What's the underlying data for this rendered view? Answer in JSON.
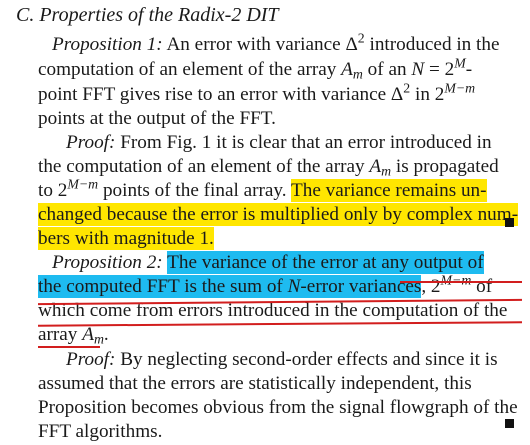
{
  "section": {
    "heading": "C. Properties of the Radix-2 DIT"
  },
  "prop1": {
    "label": "Proposition 1:",
    "l1_text": "An error with variance Δ",
    "l1_sup": "2",
    "l1_tail": " introduced in the",
    "l2_a": "computation of an element of the array ",
    "l2_A": "A",
    "l2_m": "m",
    "l2_b": " of an ",
    "l2_N": "N",
    "l2_c": " = 2",
    "l2_sup": "M",
    "l2_d": "-",
    "l3_a": "point FFT gives rise to an error with variance Δ",
    "l3_sup1": "2",
    "l3_b": " in 2",
    "l3_sup2": "M−m",
    "l4": "points at the output of the FFT."
  },
  "proof1": {
    "label": "Proof:",
    "l1": " From Fig. 1 it is clear that an error introduced in",
    "l2_a": "the computation of an element of the array ",
    "l2_A": "A",
    "l2_m": "m",
    "l2_b": " is propagated",
    "l3_a": "to 2",
    "l3_sup": "M−m",
    "l3_b": " points of the final array.  ",
    "l3_hl": "The variance remains un-",
    "l4_hl": "changed because the error is multiplied only by complex num-",
    "l5_hl": "bers with magnitude 1."
  },
  "prop2": {
    "label": "Proposition 2:",
    "l1_hl": "The variance of the error at any output of",
    "l2_hl_a": "the computed FFT is the sum of ",
    "l2_hl_N": "N",
    "l2_hl_b": "-error variances",
    "l2_c": ", 2",
    "l2_sup": "M−m",
    "l2_d": "  of",
    "l3": "which come from errors introduced in the computation of the",
    "l4_a": "array ",
    "l4_A": "A",
    "l4_m": "m",
    "l4_b": "."
  },
  "proof2": {
    "label": "Proof:",
    "l1": " By neglecting second-order effects and since it is",
    "l2": "assumed that the errors are statistically independent, this",
    "l3": "Proposition becomes obvious from the signal flowgraph of the",
    "l4": "FFT algorithms."
  },
  "colors": {
    "highlight_yellow": "#ffe600",
    "highlight_blue": "#1ebbf0",
    "underline_red": "#d21e1e"
  }
}
